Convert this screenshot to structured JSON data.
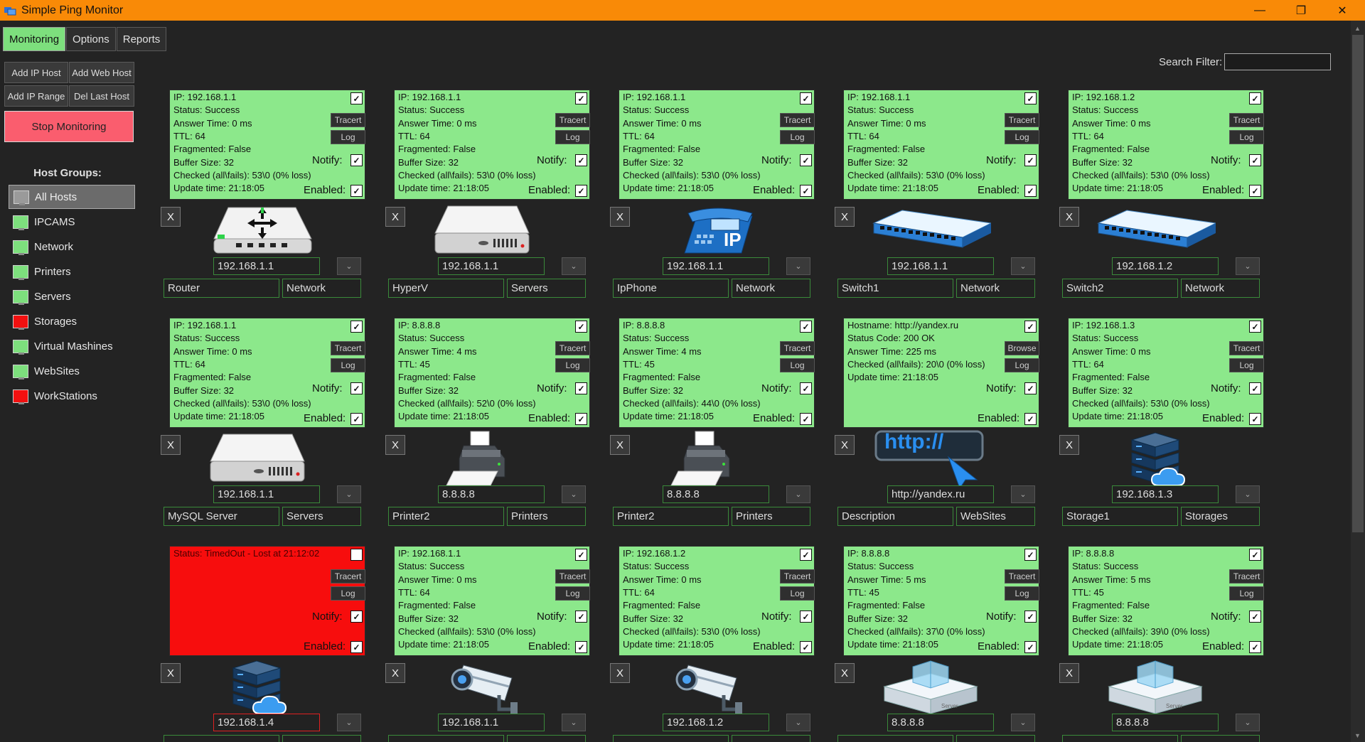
{
  "window": {
    "title": "Simple Ping Monitor",
    "minimize": "—",
    "maximize": "❐",
    "close": "✕"
  },
  "tabs": [
    "Monitoring",
    "Options",
    "Reports"
  ],
  "toolbar": {
    "add_ip_host": "Add IP Host",
    "add_web_host": "Add Web Host",
    "add_ip_range": "Add IP Range",
    "del_last_host": "Del Last Host",
    "stop": "Stop Monitoring"
  },
  "host_groups": {
    "title": "Host Groups:",
    "items": [
      {
        "label": "All Hosts",
        "color": "#9a9a9a"
      },
      {
        "label": "IPCAMS",
        "color": "#7ddf7d"
      },
      {
        "label": "Network",
        "color": "#7ddf7d"
      },
      {
        "label": "Printers",
        "color": "#7ddf7d"
      },
      {
        "label": "Servers",
        "color": "#7ddf7d"
      },
      {
        "label": "Storages",
        "color": "#f21010"
      },
      {
        "label": "Virtual Mashines",
        "color": "#7ddf7d"
      },
      {
        "label": "WebSites",
        "color": "#7ddf7d"
      },
      {
        "label": "WorkStations",
        "color": "#f21010"
      }
    ]
  },
  "search": {
    "label": "Search Filter:",
    "value": ""
  },
  "labels": {
    "tracert": "Tracert",
    "log": "Log",
    "browse": "Browse",
    "notify": "Notify:",
    "enabled": "Enabled:",
    "remove": "X",
    "dropdown": "⌄",
    "check": "✓"
  },
  "hosts": [
    {
      "type": "ip",
      "icon": "router-icon",
      "status": "ok",
      "lines": [
        "IP: 192.168.1.1",
        "Status: Success",
        "Answer Time: 0 ms",
        "TTL: 64",
        "Fragmented: False",
        "Buffer Size: 32",
        "Checked (all\\fails): 53\\0 (0% loss)",
        "Update time: 21:18:05"
      ],
      "address": "192.168.1.1",
      "name": "Router",
      "group": "Network"
    },
    {
      "type": "ip",
      "icon": "server-icon",
      "status": "ok",
      "lines": [
        "IP: 192.168.1.1",
        "Status: Success",
        "Answer Time: 0 ms",
        "TTL: 64",
        "Fragmented: False",
        "Buffer Size: 32",
        "Checked (all\\fails): 53\\0 (0% loss)",
        "Update time: 21:18:05"
      ],
      "address": "192.168.1.1",
      "name": "HyperV",
      "group": "Servers"
    },
    {
      "type": "ip",
      "icon": "ip-phone-icon",
      "status": "ok",
      "lines": [
        "IP: 192.168.1.1",
        "Status: Success",
        "Answer Time: 0 ms",
        "TTL: 64",
        "Fragmented: False",
        "Buffer Size: 32",
        "Checked (all\\fails): 53\\0 (0% loss)",
        "Update time: 21:18:05"
      ],
      "address": "192.168.1.1",
      "name": "IpPhone",
      "group": "Network"
    },
    {
      "type": "ip",
      "icon": "switch-icon",
      "status": "ok",
      "lines": [
        "IP: 192.168.1.1",
        "Status: Success",
        "Answer Time: 0 ms",
        "TTL: 64",
        "Fragmented: False",
        "Buffer Size: 32",
        "Checked (all\\fails): 53\\0 (0% loss)",
        "Update time: 21:18:05"
      ],
      "address": "192.168.1.1",
      "name": "Switch1",
      "group": "Network"
    },
    {
      "type": "ip",
      "icon": "switch-icon",
      "status": "ok",
      "lines": [
        "IP: 192.168.1.2",
        "Status: Success",
        "Answer Time: 0 ms",
        "TTL: 64",
        "Fragmented: False",
        "Buffer Size: 32",
        "Checked (all\\fails): 53\\0 (0% loss)",
        "Update time: 21:18:05"
      ],
      "address": "192.168.1.2",
      "name": "Switch2",
      "group": "Network"
    },
    {
      "type": "ip",
      "icon": "server-icon",
      "status": "ok",
      "lines": [
        "IP: 192.168.1.1",
        "Status: Success",
        "Answer Time: 0 ms",
        "TTL: 64",
        "Fragmented: False",
        "Buffer Size: 32",
        "Checked (all\\fails): 53\\0 (0% loss)",
        "Update time: 21:18:05"
      ],
      "address": "192.168.1.1",
      "name": "MySQL Server",
      "group": "Servers"
    },
    {
      "type": "ip",
      "icon": "printer-icon",
      "status": "ok",
      "lines": [
        "IP: 8.8.8.8",
        "Status: Success",
        "Answer Time: 4 ms",
        "TTL: 45",
        "Fragmented: False",
        "Buffer Size: 32",
        "Checked (all\\fails): 52\\0 (0% loss)",
        "Update time: 21:18:05"
      ],
      "address": "8.8.8.8",
      "name": "Printer2",
      "group": "Printers"
    },
    {
      "type": "ip",
      "icon": "printer-icon",
      "status": "ok",
      "lines": [
        "IP: 8.8.8.8",
        "Status: Success",
        "Answer Time: 4 ms",
        "TTL: 45",
        "Fragmented: False",
        "Buffer Size: 32",
        "Checked (all\\fails): 44\\0 (0% loss)",
        "Update time: 21:18:05"
      ],
      "address": "8.8.8.8",
      "name": "Printer2",
      "group": "Printers"
    },
    {
      "type": "web",
      "icon": "http-icon",
      "status": "ok",
      "http_text": "http://",
      "lines": [
        "Hostname: http://yandex.ru",
        "Status Code: 200 OK",
        "Answer Time: 225 ms",
        "Checked (all\\fails): 20\\0 (0% loss)",
        "Update time: 21:18:05"
      ],
      "address": "http://yandex.ru",
      "name": "Description",
      "group": "WebSites"
    },
    {
      "type": "ip",
      "icon": "storage-cloud-icon",
      "status": "ok",
      "lines": [
        "IP: 192.168.1.3",
        "Status: Success",
        "Answer Time: 0 ms",
        "TTL: 64",
        "Fragmented: False",
        "Buffer Size: 32",
        "Checked (all\\fails): 53\\0 (0% loss)",
        "Update time: 21:18:05"
      ],
      "address": "192.168.1.3",
      "name": "Storage1",
      "group": "Storages"
    },
    {
      "type": "ip",
      "icon": "storage-cloud-icon",
      "status": "fail",
      "lines": [
        "Status: TimedOut - Lost at 21:12:02"
      ],
      "address": "192.168.1.4",
      "name": "",
      "group": ""
    },
    {
      "type": "ip",
      "icon": "ip-camera-icon",
      "status": "ok",
      "lines": [
        "IP: 192.168.1.1",
        "Status: Success",
        "Answer Time: 0 ms",
        "TTL: 64",
        "Fragmented: False",
        "Buffer Size: 32",
        "Checked (all\\fails): 53\\0 (0% loss)",
        "Update time: 21:18:05"
      ],
      "address": "192.168.1.1",
      "name": "",
      "group": ""
    },
    {
      "type": "ip",
      "icon": "ip-camera-icon",
      "status": "ok",
      "lines": [
        "IP: 192.168.1.2",
        "Status: Success",
        "Answer Time: 0 ms",
        "TTL: 64",
        "Fragmented: False",
        "Buffer Size: 32",
        "Checked (all\\fails): 53\\0 (0% loss)",
        "Update time: 21:18:05"
      ],
      "address": "192.168.1.2",
      "name": "",
      "group": ""
    },
    {
      "type": "ip",
      "icon": "server-rack-icon",
      "status": "ok",
      "lines": [
        "IP: 8.8.8.8",
        "Status: Success",
        "Answer Time: 5 ms",
        "TTL: 45",
        "Fragmented: False",
        "Buffer Size: 32",
        "Checked (all\\fails): 37\\0 (0% loss)",
        "Update time: 21:18:05"
      ],
      "address": "8.8.8.8",
      "name": "",
      "group": ""
    },
    {
      "type": "ip",
      "icon": "server-rack-icon",
      "status": "ok",
      "lines": [
        "IP: 8.8.8.8",
        "Status: Success",
        "Answer Time: 5 ms",
        "TTL: 45",
        "Fragmented: False",
        "Buffer Size: 32",
        "Checked (all\\fails): 39\\0 (0% loss)",
        "Update time: 21:18:05"
      ],
      "address": "8.8.8.8",
      "name": "",
      "group": ""
    }
  ]
}
